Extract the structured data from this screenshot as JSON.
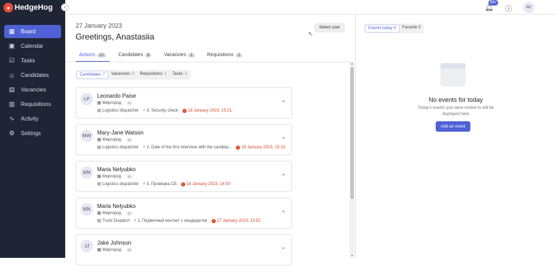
{
  "brand": {
    "name": "HedgeHog"
  },
  "sidebar": {
    "items": [
      {
        "label": "Board",
        "icon": "grid-icon",
        "active": true
      },
      {
        "label": "Calendar",
        "icon": "calendar-icon"
      },
      {
        "label": "Tasks",
        "icon": "check-square-icon"
      },
      {
        "label": "Candidates",
        "icon": "user-icon"
      },
      {
        "label": "Vacancies",
        "icon": "briefcase-icon"
      },
      {
        "label": "Requisitions",
        "icon": "document-icon"
      },
      {
        "label": "Activity",
        "icon": "activity-icon"
      },
      {
        "label": "Settings",
        "icon": "gear-icon"
      }
    ]
  },
  "topbar": {
    "notifications_badge": "99+",
    "avatar_initials": "AV"
  },
  "header": {
    "date": "27 January 2023",
    "greeting": "Greetings, Anastasiia",
    "select_user": "Select user"
  },
  "tabs": [
    {
      "label": "Actions",
      "count": "10",
      "active": true
    },
    {
      "label": "Candidates",
      "count": "8"
    },
    {
      "label": "Vacancies",
      "count": "2"
    },
    {
      "label": "Requisitions",
      "count": "2"
    }
  ],
  "subtabs": [
    {
      "label": "Candidates",
      "count": "7",
      "active": true
    },
    {
      "label": "Vacancies",
      "count": "0"
    },
    {
      "label": "Requisitions",
      "count": "1"
    },
    {
      "label": "Tasks",
      "count": "2"
    }
  ],
  "cards": [
    {
      "initials": "LP",
      "name": "Leonardo Paise",
      "city": "Миргород",
      "city_badge": "V",
      "vacancy": "Logistics dispatcher",
      "stage": "3. Security check",
      "date": "18 January 2023, 15:21"
    },
    {
      "initials": "MW",
      "name": "Mary-Jane Watson",
      "city": "Миргород",
      "city_badge": "V",
      "vacancy": "Logistics dispatcher",
      "stage": "2. Date of the first interview with the candida...",
      "date": "18 January 2023, 15:13"
    },
    {
      "initials": "MN",
      "name": "Maria Nelyubko",
      "city": "Миргород",
      "city_badge": "V",
      "vacancy": "Logistics dispatcher",
      "stage": "3. Проверка СБ",
      "date": "18 January 2023, 14:00"
    },
    {
      "initials": "MN",
      "name": "Maria Nelyubko",
      "city": "Миргород",
      "city_badge": "V",
      "vacancy": "Truck Dispatch",
      "stage": "1. Первичный контакт с кандидатом",
      "date": "17 January 2023, 13:52"
    },
    {
      "initials": "JJ",
      "name": "Jake Johnson",
      "city": "Миргород",
      "city_badge": "V",
      "vacancy": "",
      "stage": "",
      "date": ""
    }
  ],
  "events": {
    "tabs": [
      {
        "label": "Events today",
        "count": "0",
        "active": true
      },
      {
        "label": "Favorite",
        "count": "0"
      }
    ],
    "empty_title": "No events for today",
    "empty_sub": "Today's events you were invited to will be displayed here",
    "add_label": "Add an event"
  }
}
